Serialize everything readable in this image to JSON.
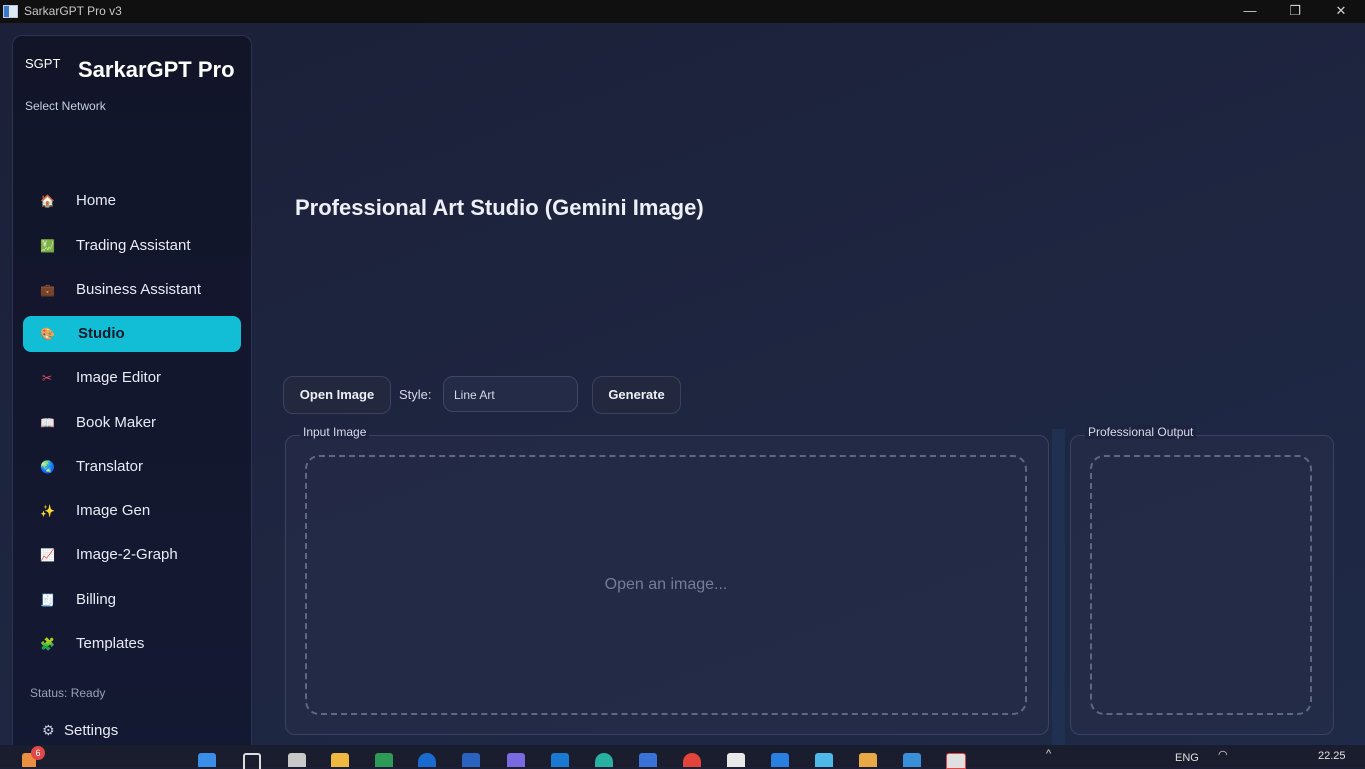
{
  "window": {
    "title": "SarkarGPT Pro v3",
    "minimize": "—",
    "maximize": "❐",
    "close": "✕"
  },
  "sidebar": {
    "logo_small": "SGPT",
    "logo_title": "SarkarGPT Pro",
    "network_label": "Select Network",
    "items": [
      {
        "label": "Home",
        "icon": "house-icon",
        "glyph": "🏠",
        "color": "#e87a4a"
      },
      {
        "label": "Trading Assistant",
        "icon": "chart-up-icon",
        "glyph": "💹",
        "color": "#5ccc6a"
      },
      {
        "label": "Business Assistant",
        "icon": "briefcase-icon",
        "glyph": "💼",
        "color": "#9a6a4a"
      },
      {
        "label": "Studio",
        "icon": "palette-icon",
        "glyph": "🎨",
        "color": "#f0b0c0",
        "active": true
      },
      {
        "label": "Image Editor",
        "icon": "scissors-icon",
        "glyph": "✂",
        "color": "#e05060"
      },
      {
        "label": "Book Maker",
        "icon": "book-icon",
        "glyph": "📖",
        "color": "#e8e8f0"
      },
      {
        "label": "Translator",
        "icon": "globe-icon",
        "glyph": "🌏",
        "color": "#4aa8e0"
      },
      {
        "label": "Image Gen",
        "icon": "sparkles-icon",
        "glyph": "✨",
        "color": "#f0c040"
      },
      {
        "label": "Image-2-Graph",
        "icon": "line-chart-icon",
        "glyph": "📈",
        "color": "#c8d0e8"
      },
      {
        "label": "Billing",
        "icon": "receipt-icon",
        "glyph": "🧾",
        "color": "#d8dce8"
      },
      {
        "label": "Templates",
        "icon": "puzzle-icon",
        "glyph": "🧩",
        "color": "#6ad06a"
      }
    ],
    "status": "Status: Ready",
    "settings_label": "Settings",
    "settings_icon": "gear-icon"
  },
  "main": {
    "page_title": "Professional Art Studio (Gemini Image)",
    "open_button": "Open Image",
    "style_label": "Style:",
    "style_value": "Line Art",
    "generate_button": "Generate",
    "input_panel_label": "Input Image",
    "input_placeholder": "Open an image...",
    "output_panel_label": "Professional Output"
  },
  "taskbar": {
    "badge_count": "6",
    "language": "ENG",
    "time": "22.25"
  },
  "colors": {
    "accent": "#11bed6",
    "background": "#1c2038",
    "sidebar": "#121528"
  }
}
